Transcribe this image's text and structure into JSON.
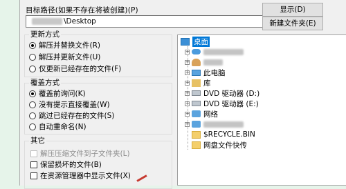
{
  "dialog": {
    "path_label": "目标路径(如果不存在将被创建)(P)",
    "path_value": "\\Desktop",
    "show_button": "显示(D)",
    "new_folder_button": "新建文件夹(E)"
  },
  "update_mode": {
    "title": "更新方式",
    "options": [
      {
        "label": "解压并替换文件(R)",
        "selected": true
      },
      {
        "label": "解压并更新文件(U)",
        "selected": false
      },
      {
        "label": "仅更新已经存在的文件(F)",
        "selected": false
      }
    ]
  },
  "overwrite_mode": {
    "title": "覆盖方式",
    "options": [
      {
        "label": "覆盖前询问(K)",
        "selected": true
      },
      {
        "label": "没有提示直接覆盖(W)",
        "selected": false
      },
      {
        "label": "跳过已经存在的文件(S)",
        "selected": false
      },
      {
        "label": "自动重命名(N)",
        "selected": false
      }
    ]
  },
  "other": {
    "title": "其它",
    "options": [
      {
        "label": "解压压缩文件到子文件夹(L)",
        "disabled": true
      },
      {
        "label": "保留损坏的文件(B)",
        "disabled": false
      },
      {
        "label": "在资源管理器中显示文件(X)",
        "disabled": false
      }
    ]
  },
  "tree": {
    "items": [
      {
        "label": "桌面",
        "icon": "desktop-icon",
        "selected": true
      },
      {
        "label": "",
        "icon": "cloud-icon"
      },
      {
        "label": "",
        "icon": "user-icon"
      },
      {
        "label": "此电脑",
        "icon": "computer-icon"
      },
      {
        "label": "库",
        "icon": "library-icon"
      },
      {
        "label": "DVD 驱动器 (D:)",
        "icon": "dvd-drive-icon"
      },
      {
        "label": "DVD 驱动器 (E:)",
        "icon": "dvd-drive-icon"
      },
      {
        "label": "网络",
        "icon": "network-icon"
      },
      {
        "label": "",
        "icon": "network-share-icon"
      },
      {
        "label": "$RECYCLE.BIN",
        "icon": "folder-icon"
      },
      {
        "label": "网盘文件快传",
        "icon": "folder-icon"
      }
    ]
  },
  "colors": {
    "dialog_bg": "#f0f0f0",
    "selection": "#0078d7",
    "page_bg": "#e6f4ea"
  }
}
